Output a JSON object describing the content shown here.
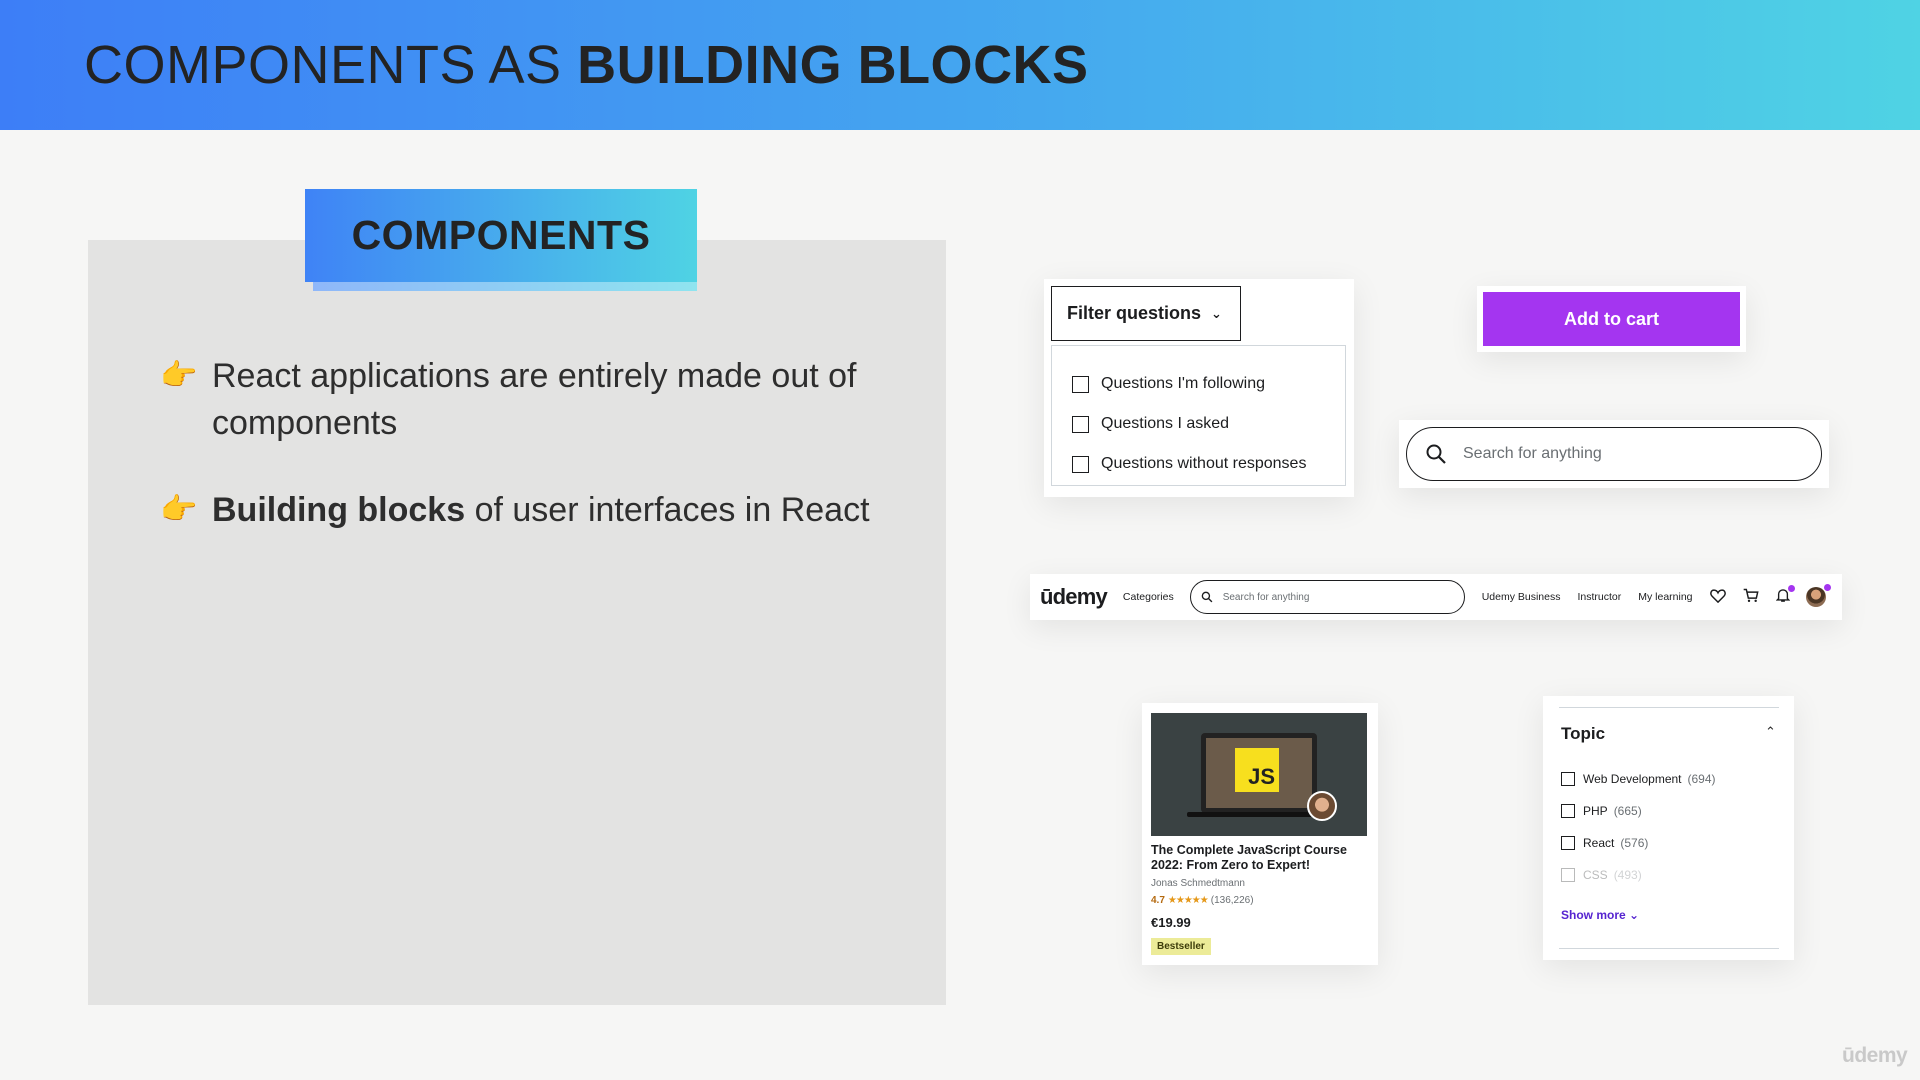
{
  "header": {
    "title_light": "COMPONENTS AS ",
    "title_bold": "BUILDING BLOCKS"
  },
  "panel": {
    "tag": "COMPONENTS",
    "bullets": [
      {
        "icon": "pointing-hand-icon",
        "bold": "",
        "text": "React applications are entirely made out of components"
      },
      {
        "icon": "pointing-hand-icon",
        "bold": "Building blocks",
        "text": " of user interfaces in React"
      }
    ]
  },
  "filter": {
    "button_label": "Filter questions",
    "options": [
      "Questions I'm following",
      "Questions I asked",
      "Questions without responses"
    ]
  },
  "add_to_cart": {
    "label": "Add to cart",
    "color": "#a435f0"
  },
  "search": {
    "placeholder": "Search for anything"
  },
  "navbar": {
    "logo": "ūdemy",
    "categories": "Categories",
    "search_placeholder": "Search for anything",
    "links": [
      "Udemy Business",
      "Instructor",
      "My learning"
    ],
    "icons": [
      "heart-icon",
      "cart-icon",
      "bell-icon",
      "avatar"
    ]
  },
  "course": {
    "title": "The Complete JavaScript Course 2022: From Zero to Expert!",
    "author": "Jonas Schmedtmann",
    "rating": "4.7",
    "stars": "★★★★★",
    "reviews": "(136,226)",
    "price": "€19.99",
    "badge": "Bestseller",
    "thumb_text": "JS"
  },
  "topic": {
    "title": "Topic",
    "items": [
      {
        "label": "Web Development",
        "count": "(694)"
      },
      {
        "label": "PHP",
        "count": "(665)"
      },
      {
        "label": "React",
        "count": "(576)"
      },
      {
        "label": "CSS",
        "count": "(493)"
      }
    ],
    "show_more": "Show more"
  },
  "watermark": "ūdemy"
}
